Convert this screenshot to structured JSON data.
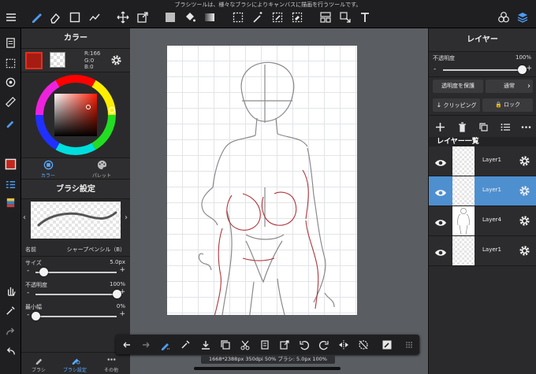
{
  "hint_text": "ブラシツールは、様々なブラシによりキャンバスに描画を行うツールです。",
  "color_panel": {
    "title": "カラー",
    "r": "R:166",
    "g": "G:0",
    "b": "B:0",
    "main_color": "#a61c12",
    "tabs": [
      {
        "label": "カラー",
        "icon": "color-circle-icon",
        "active": true
      },
      {
        "label": "パレット",
        "icon": "palette-icon",
        "active": false
      }
    ]
  },
  "brush_settings": {
    "title": "ブラシ設定",
    "name_label": "名前",
    "name_value": "シャープペンシル（B）",
    "size_label": "サイズ",
    "size_value": "5.0px",
    "size_fraction": 0.1,
    "opacity_label": "不透明度",
    "opacity_value": "100%",
    "opacity_fraction": 1.0,
    "min_width_label": "最小幅",
    "min_width_value": "0%",
    "min_width_fraction": 0.0
  },
  "bottom_tabs": [
    {
      "label": "ブラシ",
      "icon": "brush-icon"
    },
    {
      "label": "ブラシ設定",
      "icon": "brush-settings-icon",
      "active": true
    },
    {
      "label": "その他",
      "icon": "more-icon"
    }
  ],
  "layer_panel": {
    "title": "レイヤー",
    "opacity_label": "不透明度",
    "opacity_value": "100%",
    "opacity_fraction": 1.0,
    "protect_alpha_label": "透明度を保護",
    "blend_mode_label": "通常",
    "clipping_label": "クリッピング",
    "lock_label": "ロック",
    "list_title": "レイヤー一覧",
    "layers": [
      {
        "name": "Layer1",
        "selected": false
      },
      {
        "name": "Layer1",
        "selected": true
      },
      {
        "name": "Layer4",
        "selected": false
      },
      {
        "name": "Layer1",
        "selected": false
      }
    ]
  },
  "status_text": "1668*2388px 350dpi 50% ブラシ: 5.0px 100%",
  "selected_color": "#4e8fd0"
}
